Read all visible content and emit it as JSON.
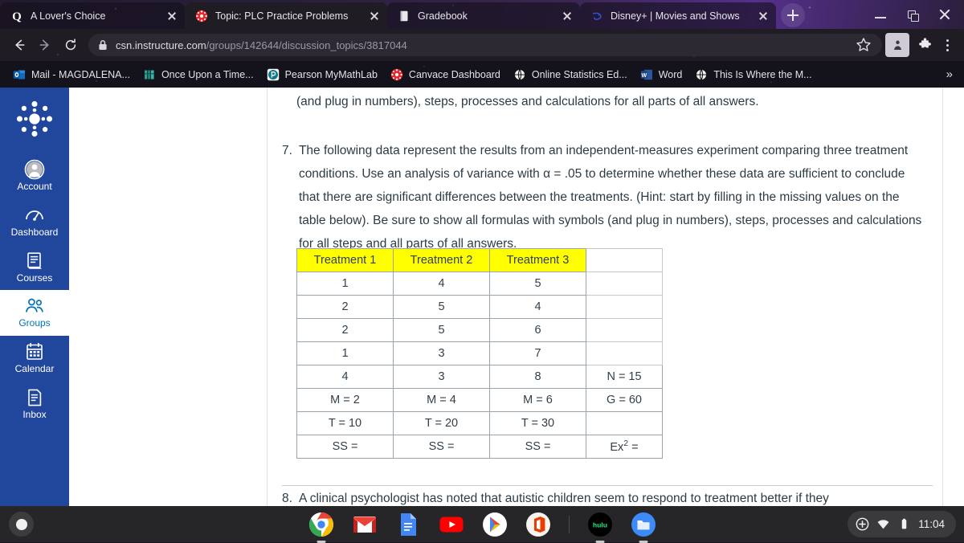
{
  "browser": {
    "tabs": [
      {
        "title": "A Lover's Choice",
        "favicon": "quora-icon",
        "active": false
      },
      {
        "title": "Topic: PLC Practice Problems",
        "favicon": "canvas-icon",
        "active": true
      },
      {
        "title": "Gradebook",
        "favicon": "book-icon",
        "active": false
      },
      {
        "title": "Disney+ | Movies and Shows",
        "favicon": "disney-icon",
        "active": false
      }
    ],
    "new_tab_label": "+",
    "window_controls": {
      "minimize": "minimize",
      "maximize": "restore",
      "close": "close"
    },
    "omnibox": {
      "url_domain": "csn.instructure.com",
      "url_path": "/groups/142644/discussion_topics/3817044",
      "secure": true,
      "back": "Back",
      "forward": "Forward",
      "reload": "Reload",
      "star": "Bookmark this tab",
      "extensions": "Extensions",
      "menu": "Customize and control Chrome"
    },
    "bookmarks": [
      {
        "label": "Mail - MAGDALENA...",
        "icon": "outlook-icon"
      },
      {
        "label": "Once Upon a Time...",
        "icon": "books-icon"
      },
      {
        "label": "Pearson MyMathLab",
        "icon": "pearson-icon"
      },
      {
        "label": "Canvace Dashboard",
        "icon": "canvas-icon"
      },
      {
        "label": "Online Statistics Ed...",
        "icon": "globe-icon"
      },
      {
        "label": "Word",
        "icon": "word-icon"
      },
      {
        "label": "This Is Where the M...",
        "icon": "globe-icon"
      }
    ],
    "bookmarks_overflow": "»"
  },
  "canvas_nav": {
    "logo": "canvas-logo",
    "items": [
      {
        "label": "Account",
        "icon": "user-circle-icon",
        "active": false
      },
      {
        "label": "Dashboard",
        "icon": "dashboard-gauge-icon",
        "active": false
      },
      {
        "label": "Courses",
        "icon": "book-icon",
        "active": false
      },
      {
        "label": "Groups",
        "icon": "group-people-icon",
        "active": true
      },
      {
        "label": "Calendar",
        "icon": "calendar-icon",
        "active": false
      },
      {
        "label": "Inbox",
        "icon": "inbox-document-icon",
        "active": false
      }
    ]
  },
  "discussion": {
    "paragraph_tail": "(and plug in numbers), steps, processes and calculations for all parts of all answers.",
    "question7": {
      "number": "7.",
      "text": "The following data represent the results from an independent-measures experiment comparing three treatment conditions. Use an analysis of variance with α = .05 to determine whether these data are sufficient to conclude that there are significant differences between the treatments. (Hint: start by filling in the missing values on the table below). Be sure to show all formulas with symbols (and plug in numbers), steps, processes and calculations for all steps and all parts of all answers."
    },
    "question8": {
      "number": "8.",
      "text": "A clinical psychologist has noted that autistic children seem to respond to treatment better if they"
    }
  },
  "anova_table": {
    "header_highlight_color": "#ffff00",
    "headers": [
      "Treatment 1",
      "Treatment 2",
      "Treatment 3",
      ""
    ],
    "rows": [
      [
        "1",
        "4",
        "5",
        ""
      ],
      [
        "2",
        "5",
        "4",
        ""
      ],
      [
        "2",
        "5",
        "6",
        ""
      ],
      [
        "1",
        "3",
        "7",
        ""
      ],
      [
        "4",
        "3",
        "8",
        "N = 15"
      ],
      [
        "M = 2",
        "M = 4",
        "M = 6",
        "G = 60"
      ],
      [
        "T = 10",
        "T = 20",
        "T = 30",
        ""
      ],
      [
        "SS =",
        "SS =",
        "SS =",
        "Ex2 ="
      ]
    ],
    "last_cell_base": "Ex",
    "last_cell_sup": "2",
    "last_cell_tail": " ="
  },
  "shelf": {
    "launcher": "launcher-button",
    "apps": [
      {
        "name": "chrome-icon",
        "running": true
      },
      {
        "name": "gmail-icon",
        "running": false
      },
      {
        "name": "google-docs-icon",
        "running": false
      },
      {
        "name": "youtube-icon",
        "running": false
      },
      {
        "name": "play-store-icon",
        "running": false
      },
      {
        "name": "office-icon",
        "running": false
      },
      {
        "name": "hulu-icon",
        "running": true,
        "label": "hulu"
      },
      {
        "name": "files-icon",
        "running": true
      }
    ],
    "tray": {
      "time": "11:04",
      "battery": "battery-icon",
      "wifi": "wifi-icon",
      "add": "add-icon"
    }
  }
}
